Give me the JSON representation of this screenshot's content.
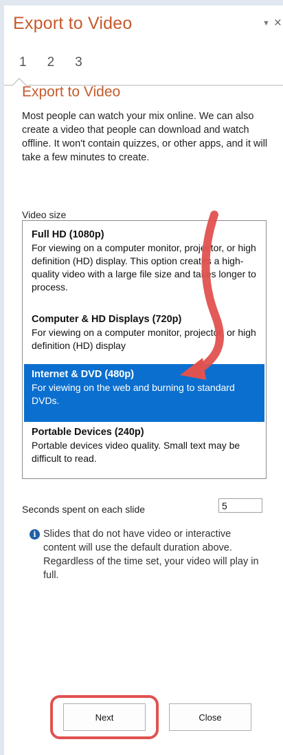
{
  "pane": {
    "title": "Export to Video",
    "dropdown_glyph": "▼",
    "close_glyph": "×"
  },
  "steps": [
    "1",
    "2",
    "3"
  ],
  "section": {
    "title": "Export to Video",
    "intro": "Most people can watch your mix online. We can also create a video that people can download and watch offline. It won't contain quizzes, or other apps, and it will take a few minutes to create."
  },
  "video_size": {
    "label": "Video size",
    "selected": "Internet & DVD (480p)",
    "options": [
      {
        "title": "Full HD (1080p)",
        "desc": "For viewing on a computer monitor, projector, or high definition (HD) display. This option creates a high-quality video with a large file size and takes longer to process."
      },
      {
        "title": "Computer & HD Displays (720p)",
        "desc": "For viewing on a computer monitor, projector, or high definition (HD) display"
      },
      {
        "title": "Internet & DVD (480p)",
        "desc": "For viewing on the web and burning to standard DVDs."
      },
      {
        "title": "Portable Devices (240p)",
        "desc": "Portable devices video quality. Small text may be difficult to read."
      }
    ]
  },
  "seconds": {
    "label": "Seconds spent on each slide",
    "value": "5"
  },
  "info": {
    "icon_glyph": "i",
    "text": "Slides that do not have video or interactive content will use the default duration above. Regardless of the time set, your video will play in full."
  },
  "buttons": {
    "next": "Next",
    "close": "Close"
  },
  "colors": {
    "accent": "#c55a2b",
    "selection": "#0b6fcf",
    "annotation": "#e0524f"
  }
}
